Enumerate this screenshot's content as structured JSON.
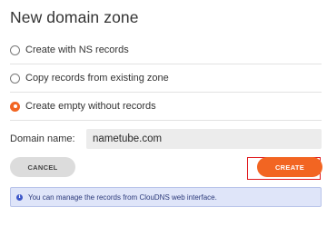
{
  "dialog": {
    "title": "New domain zone",
    "options": [
      {
        "label": "Create with NS records",
        "selected": false
      },
      {
        "label": "Copy records from existing zone",
        "selected": false
      },
      {
        "label": "Create empty without records",
        "selected": true
      }
    ],
    "domain_label": "Domain name:",
    "domain_value": "nametube.com",
    "cancel_label": "CANCEL",
    "create_label": "CREATE",
    "info_icon": "info-icon",
    "info_text": "You can manage the records from ClouDNS web interface."
  },
  "colors": {
    "accent": "#f26522",
    "highlight_outline": "#e0191e",
    "info_bg": "#dfe5f9",
    "info_icon": "#3d57c8"
  }
}
